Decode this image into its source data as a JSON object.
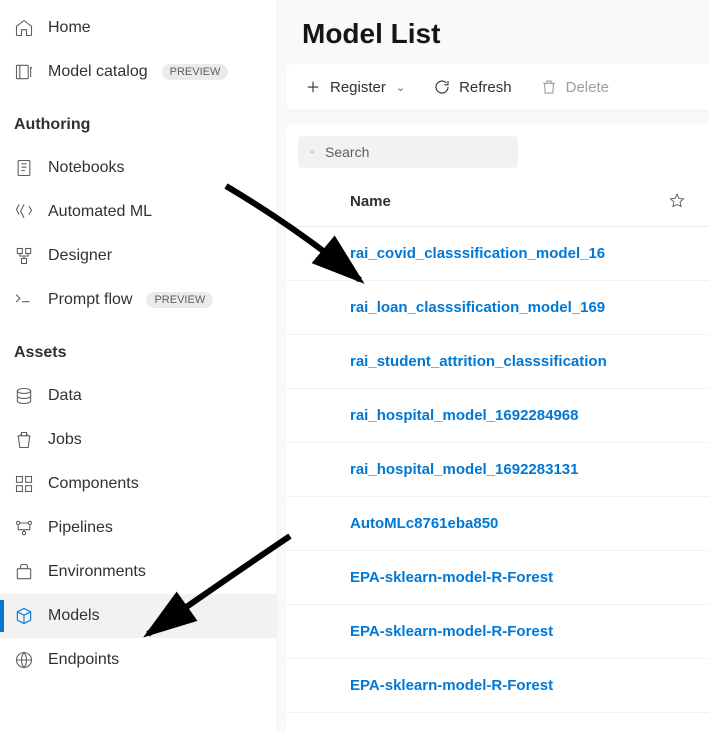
{
  "sidebar": {
    "home": "Home",
    "model_catalog": "Model catalog",
    "preview_badge": "PREVIEW",
    "section_authoring": "Authoring",
    "notebooks": "Notebooks",
    "automated_ml": "Automated ML",
    "designer": "Designer",
    "prompt_flow": "Prompt flow",
    "section_assets": "Assets",
    "data": "Data",
    "jobs": "Jobs",
    "components": "Components",
    "pipelines": "Pipelines",
    "environments": "Environments",
    "models": "Models",
    "endpoints": "Endpoints"
  },
  "main": {
    "title": "Model List",
    "commands": {
      "register": "Register",
      "refresh": "Refresh",
      "delete": "Delete"
    },
    "search_placeholder": "Search",
    "columns": {
      "name": "Name"
    },
    "rows": [
      {
        "name": "rai_covid_classsification_model_16"
      },
      {
        "name": "rai_loan_classsification_model_169"
      },
      {
        "name": "rai_student_attrition_classsification"
      },
      {
        "name": "rai_hospital_model_1692284968"
      },
      {
        "name": "rai_hospital_model_1692283131"
      },
      {
        "name": "AutoMLc8761eba850"
      },
      {
        "name": "EPA-sklearn-model-R-Forest"
      },
      {
        "name": "EPA-sklearn-model-R-Forest"
      },
      {
        "name": "EPA-sklearn-model-R-Forest"
      }
    ]
  }
}
